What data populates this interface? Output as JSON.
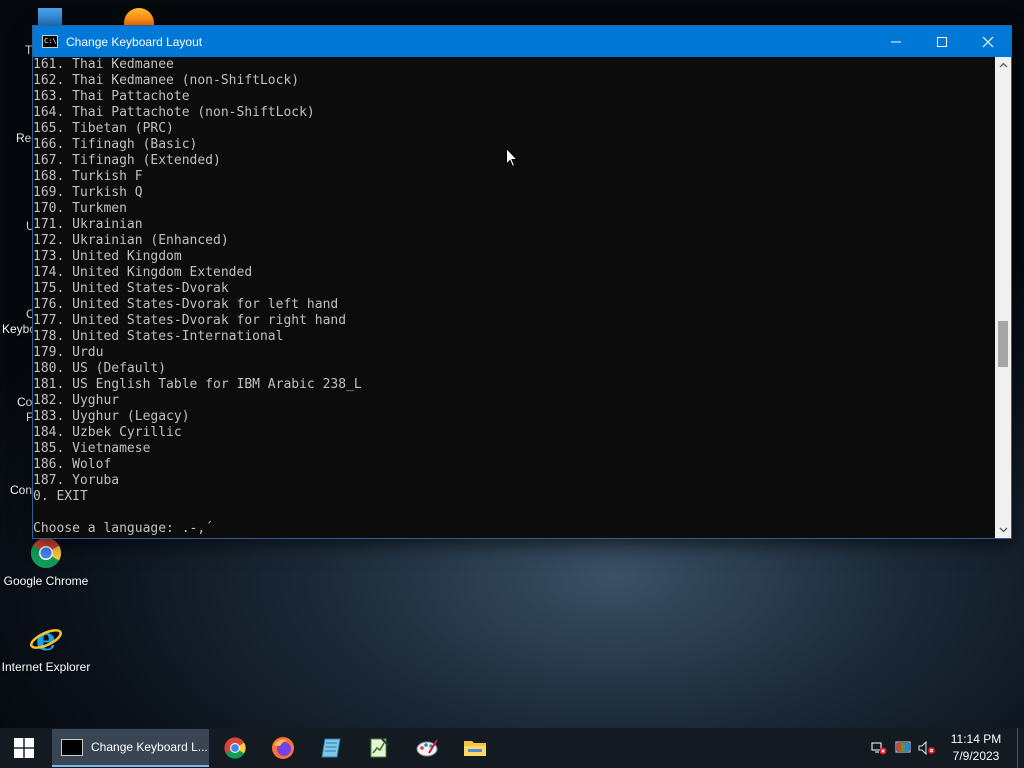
{
  "desktop": {
    "icons": [
      {
        "label": "Google Chrome"
      },
      {
        "label": "Internet Explorer"
      }
    ],
    "partial_labels": [
      "T",
      "Rec",
      "U",
      "C",
      "Keybo",
      "Co",
      "P",
      "Con"
    ]
  },
  "window": {
    "title": "Change Keyboard Layout",
    "console_lines": [
      "161. Thai Kedmanee",
      "162. Thai Kedmanee (non-ShiftLock)",
      "163. Thai Pattachote",
      "164. Thai Pattachote (non-ShiftLock)",
      "165. Tibetan (PRC)",
      "166. Tifinagh (Basic)",
      "167. Tifinagh (Extended)",
      "168. Turkish F",
      "169. Turkish Q",
      "170. Turkmen",
      "171. Ukrainian",
      "172. Ukrainian (Enhanced)",
      "173. United Kingdom",
      "174. United Kingdom Extended",
      "175. United States-Dvorak",
      "176. United States-Dvorak for left hand",
      "177. United States-Dvorak for right hand",
      "178. United States-International",
      "179. Urdu",
      "180. US (Default)",
      "181. US English Table for IBM Arabic 238_L",
      "182. Uyghur",
      "183. Uyghur (Legacy)",
      "184. Uzbek Cyrillic",
      "185. Vietnamese",
      "186. Wolof",
      "187. Yoruba",
      "0. EXIT",
      "",
      "Choose a language: .-,´"
    ]
  },
  "taskbar": {
    "active_task_label": "Change Keyboard L...",
    "clock_time": "11:14 PM",
    "clock_date": "7/9/2023"
  },
  "colors": {
    "titlebar": "#0078d7",
    "console_bg": "#0c0c0c",
    "console_text": "#c0c0c0",
    "taskbar": "#131a22"
  }
}
